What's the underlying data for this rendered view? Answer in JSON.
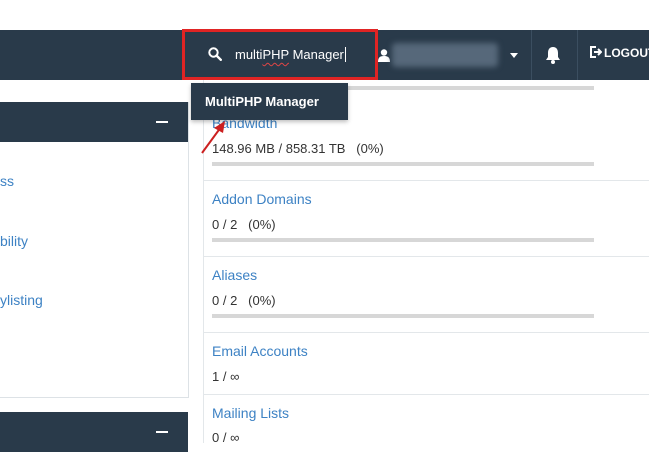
{
  "search": {
    "value_part1": "multi",
    "value_part2": "PHP",
    "value_part3": " Manager"
  },
  "header": {
    "logout_label": "LOGOUT"
  },
  "dropdown": {
    "item_label": "MultiPHP Manager"
  },
  "sidebar": {
    "items": [
      {
        "label": "ss"
      },
      {
        "label": "bility"
      },
      {
        "label": "ylisting"
      }
    ]
  },
  "stats": [
    {
      "title": "Bandwidth",
      "value": "148.96 MB / 858.31 TB   (0%)",
      "progress": 0
    },
    {
      "title": "Addon Domains",
      "value": "0 / 2   (0%)",
      "progress": 0
    },
    {
      "title": "Aliases",
      "value": "0 / 2   (0%)",
      "progress": 0
    },
    {
      "title": "Email Accounts",
      "value": "1 / ∞"
    },
    {
      "title": "Mailing Lists",
      "value": "0 / ∞"
    }
  ],
  "colors": {
    "navbar": "#293a4a",
    "link": "#3d82c4",
    "highlight": "#e02424"
  }
}
